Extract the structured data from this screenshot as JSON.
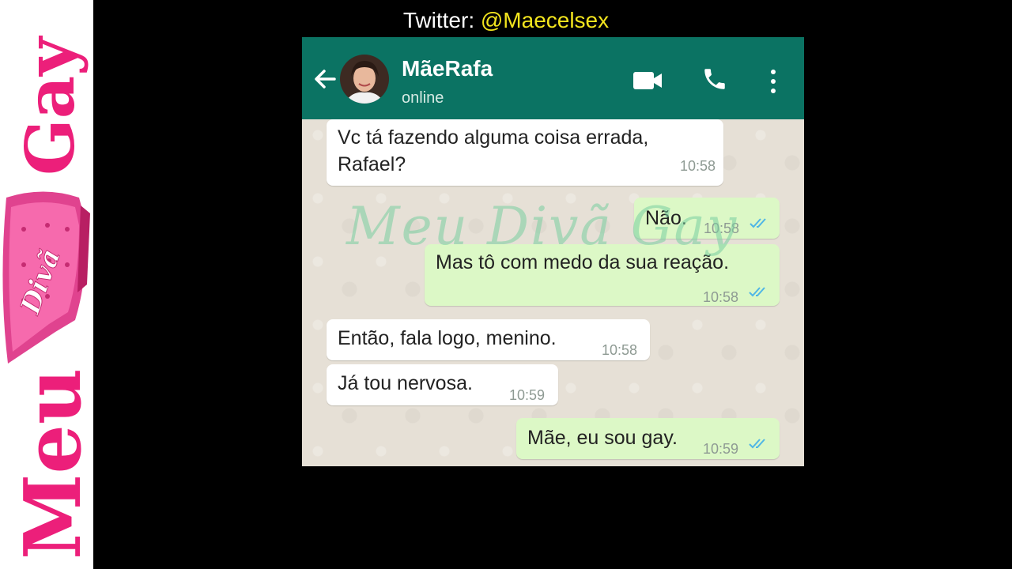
{
  "brand": {
    "word1": "Meu",
    "word2": "Gay",
    "sofa_label": "Divã",
    "accent": "#ec1f7a"
  },
  "twitter": {
    "label": "Twitter:",
    "handle": "@Maecelsex"
  },
  "chat": {
    "contact_name": "MãeRafa",
    "status": "online",
    "header_color": "#0b7363",
    "watermark": "Meu Divã Gay",
    "messages": [
      {
        "dir": "in",
        "text_line1": "Vc tá fazendo alguma coisa errada,",
        "text_line2": "Rafael?",
        "time": "10:58"
      },
      {
        "dir": "out",
        "text": "Não.",
        "time": "10:58"
      },
      {
        "dir": "out",
        "text": "Mas tô com medo da sua reação.",
        "time": "10:58"
      },
      {
        "dir": "in",
        "text": "Então, fala logo, menino.",
        "time": "10:58"
      },
      {
        "dir": "in",
        "text": "Já tou nervosa.",
        "time": "10:59"
      },
      {
        "dir": "out",
        "text": "Mãe, eu sou gay.",
        "time": "10:59"
      }
    ]
  }
}
